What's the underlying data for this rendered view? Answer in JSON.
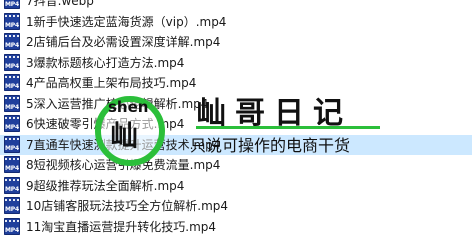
{
  "icon_name": "mp4-video-file-icon",
  "icon_tag": "MP4",
  "colors": {
    "selection": "#cce8ff",
    "icon_blue": "#1f3f9c",
    "watermark_green": "#2bbf3a"
  },
  "files": [
    {
      "name": "7抖音.webp",
      "selected": false
    },
    {
      "name": "1新手快速选定蓝海货源（vip）.mp4",
      "selected": false
    },
    {
      "name": "2店铺后台及必需设置深度详解.mp4",
      "selected": false
    },
    {
      "name": "3爆款标题核心打造方法.mp4",
      "selected": false
    },
    {
      "name": "4产品高权重上架布局技巧.mp4",
      "selected": false
    },
    {
      "name": "5深入运营推广核心逻辑解析.mp4",
      "selected": false
    },
    {
      "name": "6快速破零引爆产品方式.mp4",
      "selected": false
    },
    {
      "name": "7直通车快速测款提升运营技术.mp4",
      "selected": true
    },
    {
      "name": "8短视频核心运营引爆免费流量.mp4",
      "selected": false
    },
    {
      "name": "9超级推荐玩法全面解析.mp4",
      "selected": false
    },
    {
      "name": "10店铺客服玩法技巧全方位解析.mp4",
      "selected": false
    },
    {
      "name": "11淘宝直播运营提升转化技巧.mp4",
      "selected": false
    }
  ],
  "watermark": {
    "pinyin": "shen",
    "char": "屾",
    "title": "屾哥日记",
    "tagline": "只说可操作的电商干货"
  }
}
